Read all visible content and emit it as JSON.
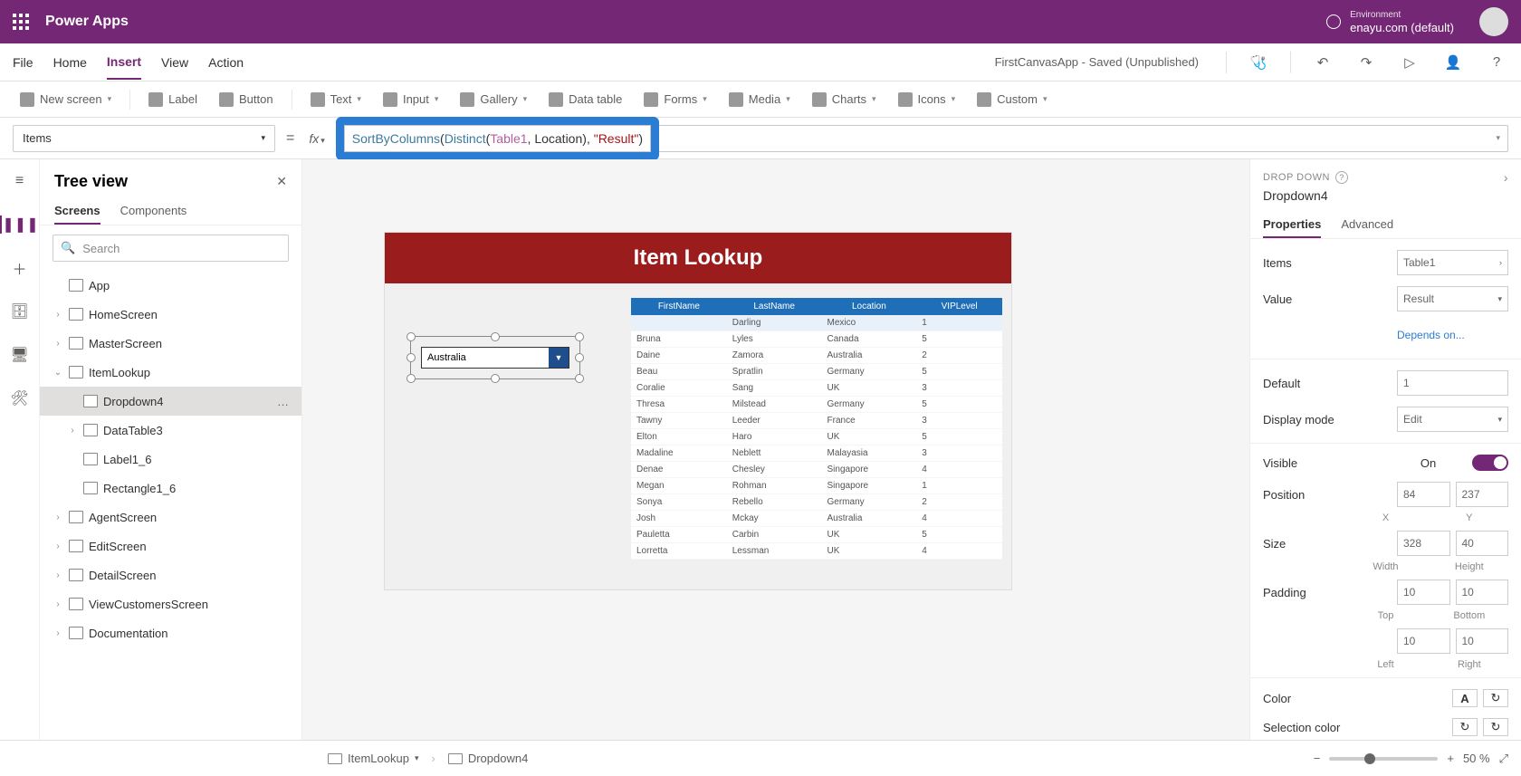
{
  "titlebar": {
    "product": "Power Apps",
    "env_label": "Environment",
    "env_name": "enayu.com (default)"
  },
  "menus": {
    "file": "File",
    "home": "Home",
    "insert": "Insert",
    "view": "View",
    "action": "Action"
  },
  "appstatus": "FirstCanvasApp - Saved (Unpublished)",
  "ribbon": {
    "newscreen": "New screen",
    "label": "Label",
    "button": "Button",
    "text": "Text",
    "input": "Input",
    "gallery": "Gallery",
    "datatable": "Data table",
    "forms": "Forms",
    "media": "Media",
    "charts": "Charts",
    "icons": "Icons",
    "custom": "Custom"
  },
  "formulabar": {
    "property": "Items"
  },
  "formula_tokens": [
    {
      "t": "SortByColumns",
      "c": "tk-fn"
    },
    {
      "t": "(",
      "c": "tk-paren"
    },
    {
      "t": "Distinct",
      "c": "tk-fn"
    },
    {
      "t": "(",
      "c": "tk-paren"
    },
    {
      "t": "Table1",
      "c": "tk-id"
    },
    {
      "t": ", ",
      "c": "tk-comma"
    },
    {
      "t": "Location",
      "c": "tk-arg"
    },
    {
      "t": ")",
      "c": "tk-paren"
    },
    {
      "t": ", ",
      "c": "tk-comma"
    },
    {
      "t": "\"Result\"",
      "c": "tk-str"
    },
    {
      "t": ")",
      "c": "tk-paren"
    }
  ],
  "treeview": {
    "title": "Tree view",
    "tab_screens": "Screens",
    "tab_components": "Components",
    "search_ph": "Search",
    "app": "App",
    "screens": [
      "HomeScreen",
      "MasterScreen",
      "ItemLookup",
      "AgentScreen",
      "EditScreen",
      "DetailScreen",
      "ViewCustomersScreen",
      "Documentation"
    ],
    "item_children": [
      "Dropdown4",
      "DataTable3",
      "Label1_6",
      "Rectangle1_6"
    ]
  },
  "canvas": {
    "app_title": "Item Lookup",
    "dropdown_value": "Australia",
    "table_headers": [
      "FirstName",
      "LastName",
      "Location",
      "VIPLevel"
    ],
    "table_rows": [
      [
        "",
        "Darling",
        "Mexico",
        "1"
      ],
      [
        "Bruna",
        "Lyles",
        "Canada",
        "5"
      ],
      [
        "Daine",
        "Zamora",
        "Australia",
        "2"
      ],
      [
        "Beau",
        "Spratlin",
        "Germany",
        "5"
      ],
      [
        "Coralie",
        "Sang",
        "UK",
        "3"
      ],
      [
        "Thresa",
        "Milstead",
        "Germany",
        "5"
      ],
      [
        "Tawny",
        "Leeder",
        "France",
        "3"
      ],
      [
        "Elton",
        "Haro",
        "UK",
        "5"
      ],
      [
        "Madaline",
        "Neblett",
        "Malayasia",
        "3"
      ],
      [
        "Denae",
        "Chesley",
        "Singapore",
        "4"
      ],
      [
        "Megan",
        "Rohman",
        "Singapore",
        "1"
      ],
      [
        "Sonya",
        "Rebello",
        "Germany",
        "2"
      ],
      [
        "Josh",
        "Mckay",
        "Australia",
        "4"
      ],
      [
        "Pauletta",
        "Carbin",
        "UK",
        "5"
      ],
      [
        "Lorretta",
        "Lessman",
        "UK",
        "4"
      ]
    ]
  },
  "props": {
    "header": "DROP DOWN",
    "name": "Dropdown4",
    "tab_properties": "Properties",
    "tab_advanced": "Advanced",
    "items": "Items",
    "items_val": "Table1",
    "value": "Value",
    "value_val": "Result",
    "depends": "Depends on...",
    "default": "Default",
    "default_val": "1",
    "displaymode": "Display mode",
    "displaymode_val": "Edit",
    "visible": "Visible",
    "visible_val": "On",
    "position": "Position",
    "pos_x": "84",
    "pos_y": "237",
    "x_lbl": "X",
    "y_lbl": "Y",
    "size": "Size",
    "size_w": "328",
    "size_h": "40",
    "w_lbl": "Width",
    "h_lbl": "Height",
    "padding": "Padding",
    "pad_t": "10",
    "pad_b": "10",
    "t_lbl": "Top",
    "b_lbl": "Bottom",
    "pad_l": "10",
    "pad_r": "10",
    "l_lbl": "Left",
    "r_lbl": "Right",
    "color": "Color",
    "selcolor": "Selection color",
    "a_glyph": "A"
  },
  "status": {
    "screen": "ItemLookup",
    "control": "Dropdown4",
    "zoom": "50 %"
  }
}
